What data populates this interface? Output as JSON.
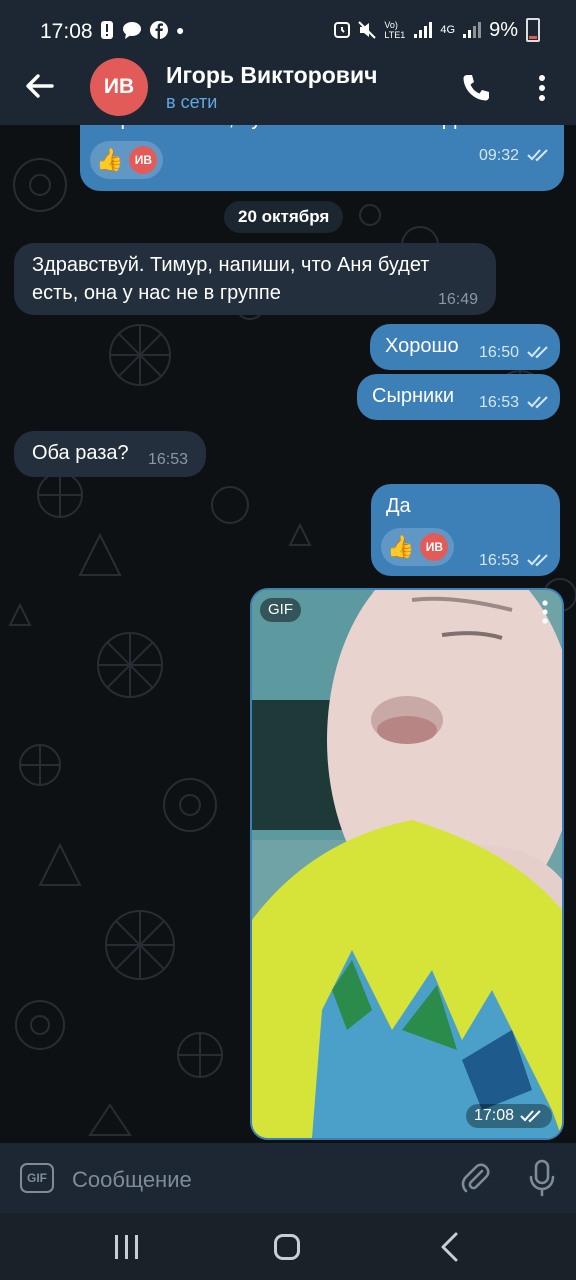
{
  "status_bar": {
    "time": "17:08",
    "battery": "9%",
    "network": "4G",
    "volte": "Vo) LTE1"
  },
  "header": {
    "avatar_initials": "ИВ",
    "title": "Игорь Викторович",
    "subtitle": "в сети"
  },
  "messages": [
    {
      "dir": "out",
      "text": "Вероняновкой, Кукленко и Сисоевой Даши",
      "time": "09:32",
      "reaction": {
        "emoji": "👍",
        "initials": "ИВ"
      }
    },
    {
      "dir": "date",
      "text": "20 октября"
    },
    {
      "dir": "in",
      "text": "Здравствуй. Тимур, напиши, что Аня будет\nесть, она у нас не в группе",
      "time": "16:49"
    },
    {
      "dir": "out",
      "text": "Хорошо",
      "time": "16:50"
    },
    {
      "dir": "out",
      "text": "Сырники",
      "time": "16:53"
    },
    {
      "dir": "in",
      "text": "Оба раза?",
      "time": "16:53"
    },
    {
      "dir": "out",
      "text": "Да",
      "time": "16:53",
      "reaction": {
        "emoji": "👍",
        "initials": "ИВ"
      }
    },
    {
      "dir": "out",
      "type": "gif",
      "badge": "GIF",
      "time": "17:08"
    }
  ],
  "input_bar": {
    "gif_label": "GIF",
    "placeholder": "Сообщение"
  },
  "colors": {
    "header_bg": "#1c2733",
    "outgoing": "#3d80b8",
    "incoming": "#242f3d",
    "link": "#5fa8e6",
    "avatar": "#e35b58"
  }
}
